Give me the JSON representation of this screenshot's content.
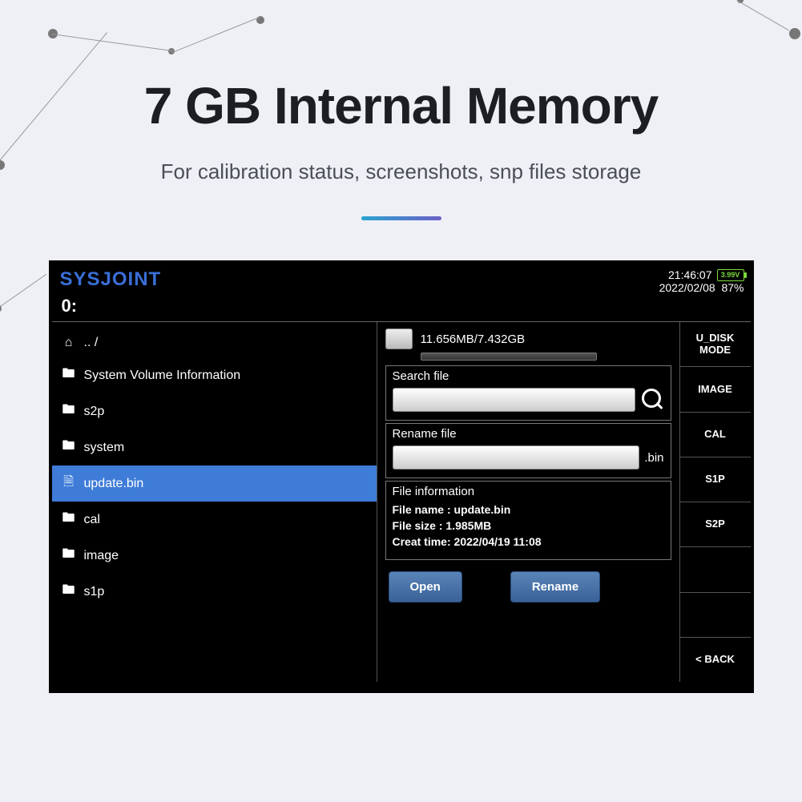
{
  "hero": {
    "title": "7 GB Internal Memory",
    "subtitle": "For calibration status, screenshots, snp files storage"
  },
  "device": {
    "brand": "SYSJOINT",
    "clock_time": "21:46:07",
    "clock_date": "2022/02/08",
    "battery_voltage": "3.99V",
    "battery_pct": "87%",
    "current_path": "0:",
    "files": [
      {
        "icon": "home",
        "label": ".. /",
        "selected": false
      },
      {
        "icon": "folder",
        "label": "System Volume Information",
        "selected": false
      },
      {
        "icon": "folder",
        "label": "s2p",
        "selected": false
      },
      {
        "icon": "folder",
        "label": "system",
        "selected": false
      },
      {
        "icon": "file",
        "label": "update.bin",
        "selected": true
      },
      {
        "icon": "folder",
        "label": "cal",
        "selected": false
      },
      {
        "icon": "folder",
        "label": "image",
        "selected": false
      },
      {
        "icon": "folder",
        "label": "s1p",
        "selected": false
      }
    ],
    "disk_usage": "11.656MB/7.432GB",
    "search_label": "Search file",
    "rename_label": "Rename file",
    "rename_ext": ".bin",
    "info_header": "File information",
    "info_name_label": "File name :",
    "info_name_value": "update.bin",
    "info_size_label": "File size   :",
    "info_size_value": "1.985MB",
    "info_time_label": "Creat time:",
    "info_time_value": "2022/04/19 11:08",
    "open_label": "Open",
    "rename_btn_label": "Rename",
    "side_buttons": [
      "U_DISK MODE",
      "IMAGE",
      "CAL",
      "S1P",
      "S2P",
      "",
      "",
      "< BACK"
    ]
  }
}
